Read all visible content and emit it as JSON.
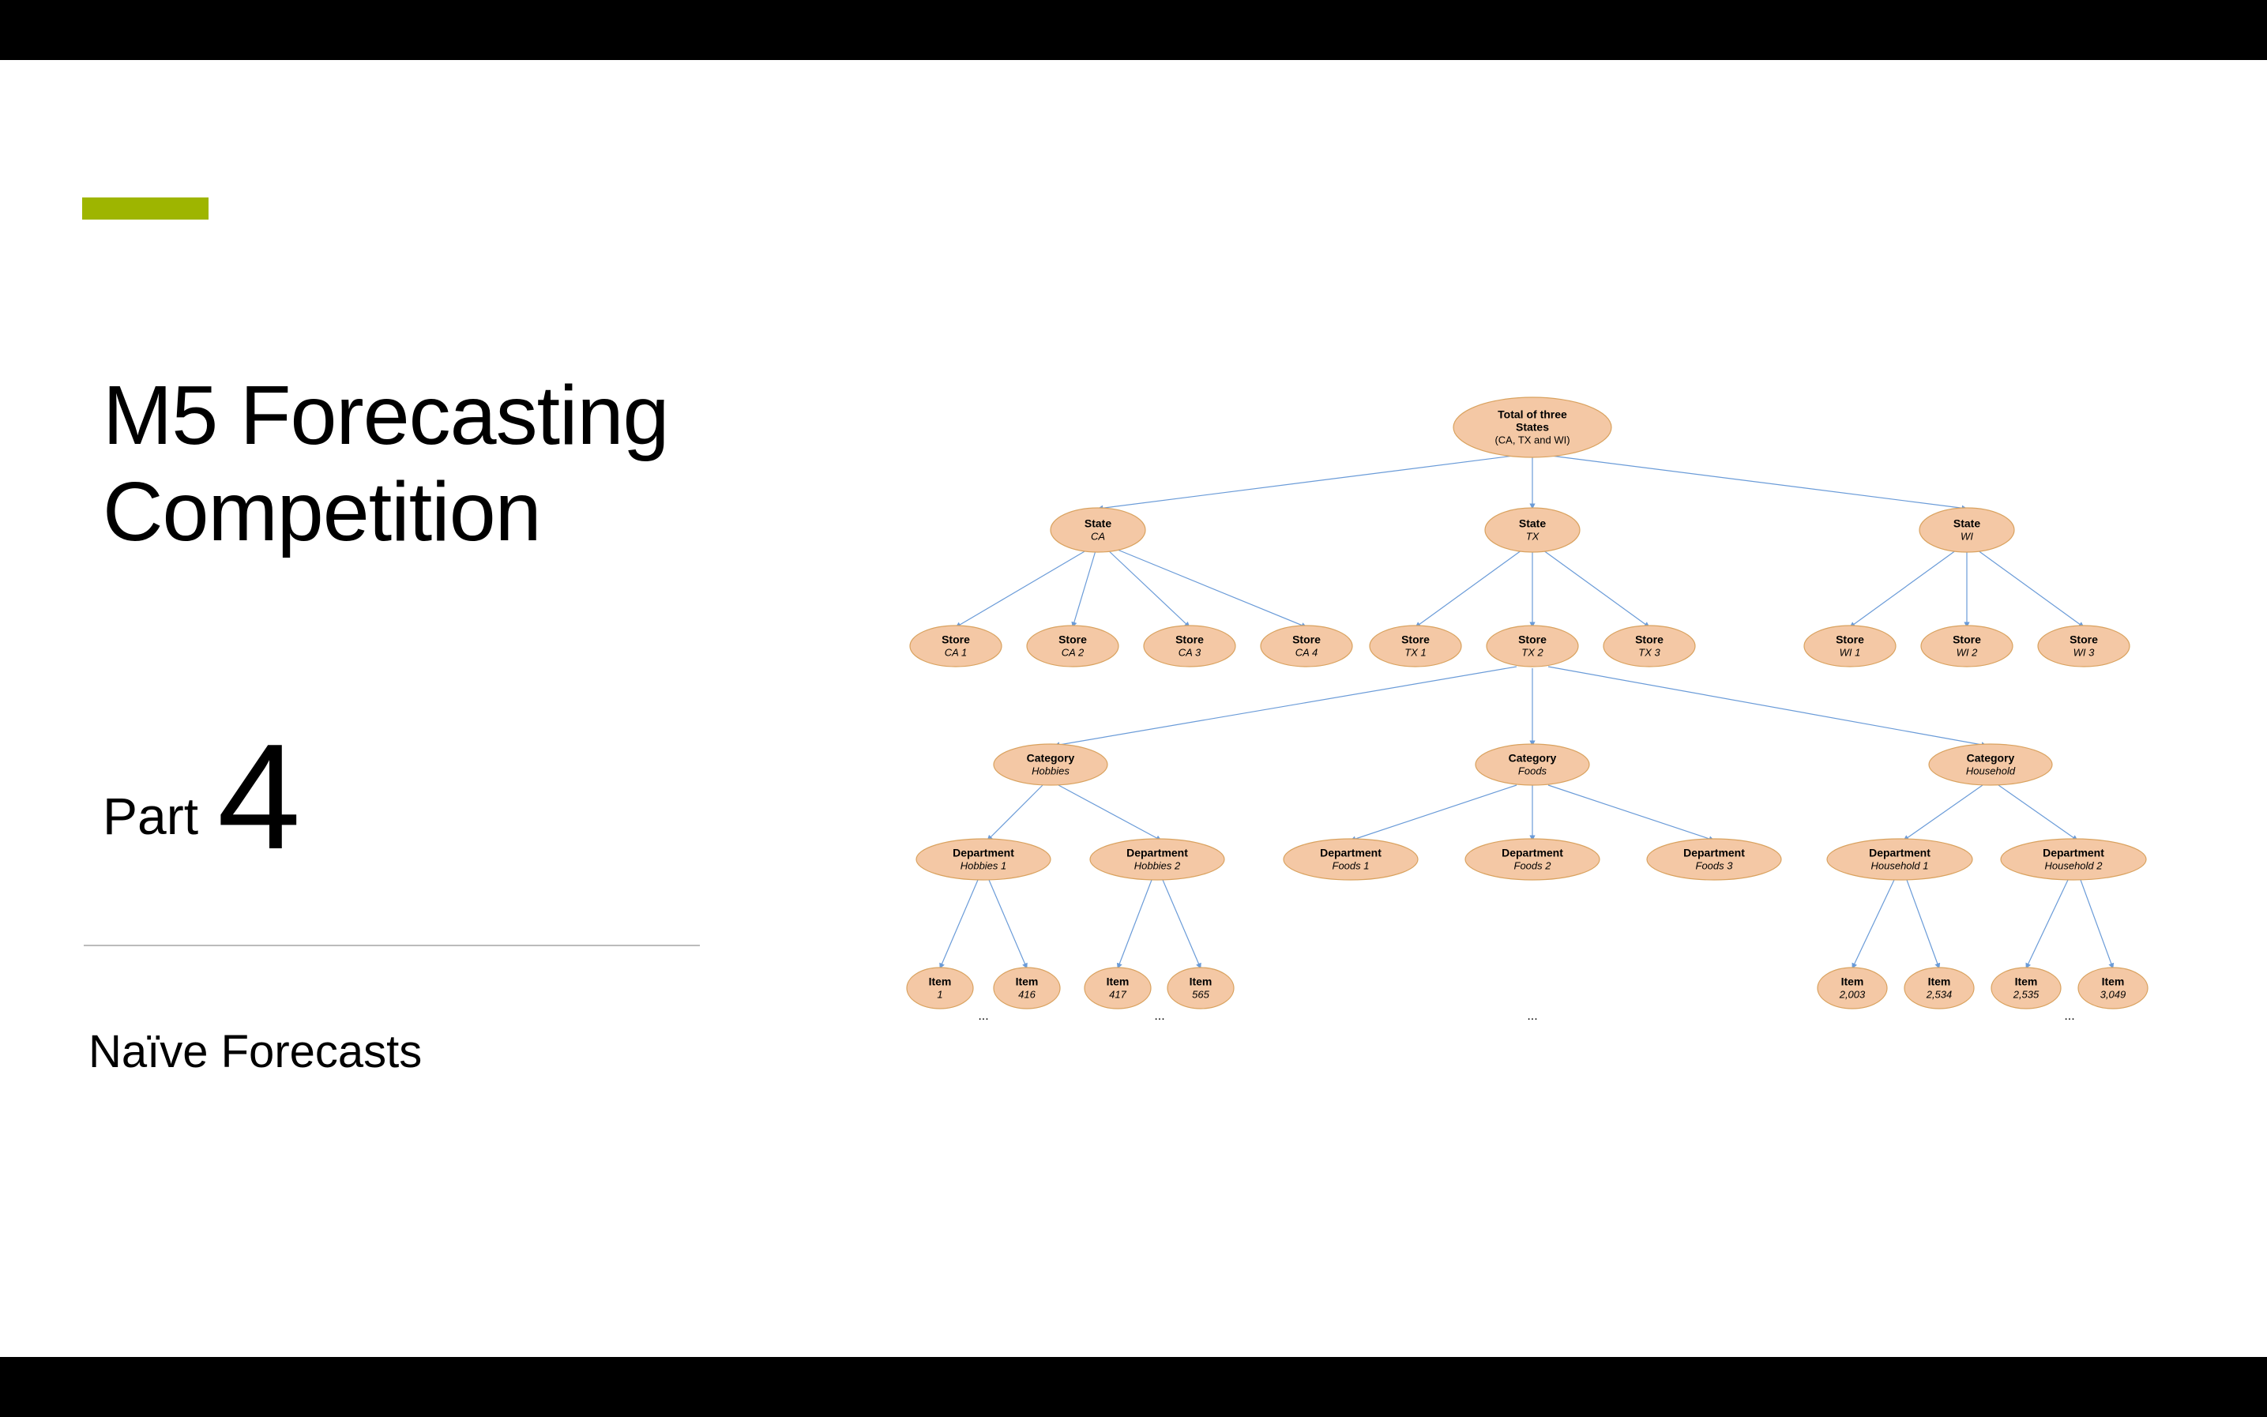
{
  "title_line1": "M5 Forecasting",
  "title_line2": "Competition",
  "part_label": "Part",
  "part_number": "4",
  "subtitle": "Naïve Forecasts",
  "tree": {
    "root": {
      "l1": "Total of three",
      "l2": "States",
      "l3": "(CA, TX and WI)"
    },
    "states": [
      {
        "l1": "State",
        "l2": "CA"
      },
      {
        "l1": "State",
        "l2": "TX"
      },
      {
        "l1": "State",
        "l2": "WI"
      }
    ],
    "stores": [
      {
        "l1": "Store",
        "l2": "CA 1"
      },
      {
        "l1": "Store",
        "l2": "CA 2"
      },
      {
        "l1": "Store",
        "l2": "CA 3"
      },
      {
        "l1": "Store",
        "l2": "CA 4"
      },
      {
        "l1": "Store",
        "l2": "TX 1"
      },
      {
        "l1": "Store",
        "l2": "TX 2"
      },
      {
        "l1": "Store",
        "l2": "TX 3"
      },
      {
        "l1": "Store",
        "l2": "WI 1"
      },
      {
        "l1": "Store",
        "l2": "WI 2"
      },
      {
        "l1": "Store",
        "l2": "WI 3"
      }
    ],
    "categories": [
      {
        "l1": "Category",
        "l2": "Hobbies"
      },
      {
        "l1": "Category",
        "l2": "Foods"
      },
      {
        "l1": "Category",
        "l2": "Household"
      }
    ],
    "departments": [
      {
        "l1": "Department",
        "l2": "Hobbies 1"
      },
      {
        "l1": "Department",
        "l2": "Hobbies 2"
      },
      {
        "l1": "Department",
        "l2": "Foods 1"
      },
      {
        "l1": "Department",
        "l2": "Foods 2"
      },
      {
        "l1": "Department",
        "l2": "Foods 3"
      },
      {
        "l1": "Department",
        "l2": "Household 1"
      },
      {
        "l1": "Department",
        "l2": "Household 2"
      }
    ],
    "items": [
      {
        "l1": "Item",
        "l2": "1"
      },
      {
        "l1": "Item",
        "l2": "416"
      },
      {
        "l1": "Item",
        "l2": "417"
      },
      {
        "l1": "Item",
        "l2": "565"
      },
      {
        "l1": "Item",
        "l2": "2,003"
      },
      {
        "l1": "Item",
        "l2": "2,534"
      },
      {
        "l1": "Item",
        "l2": "2,535"
      },
      {
        "l1": "Item",
        "l2": "3,049"
      }
    ],
    "ellipsis": "..."
  }
}
